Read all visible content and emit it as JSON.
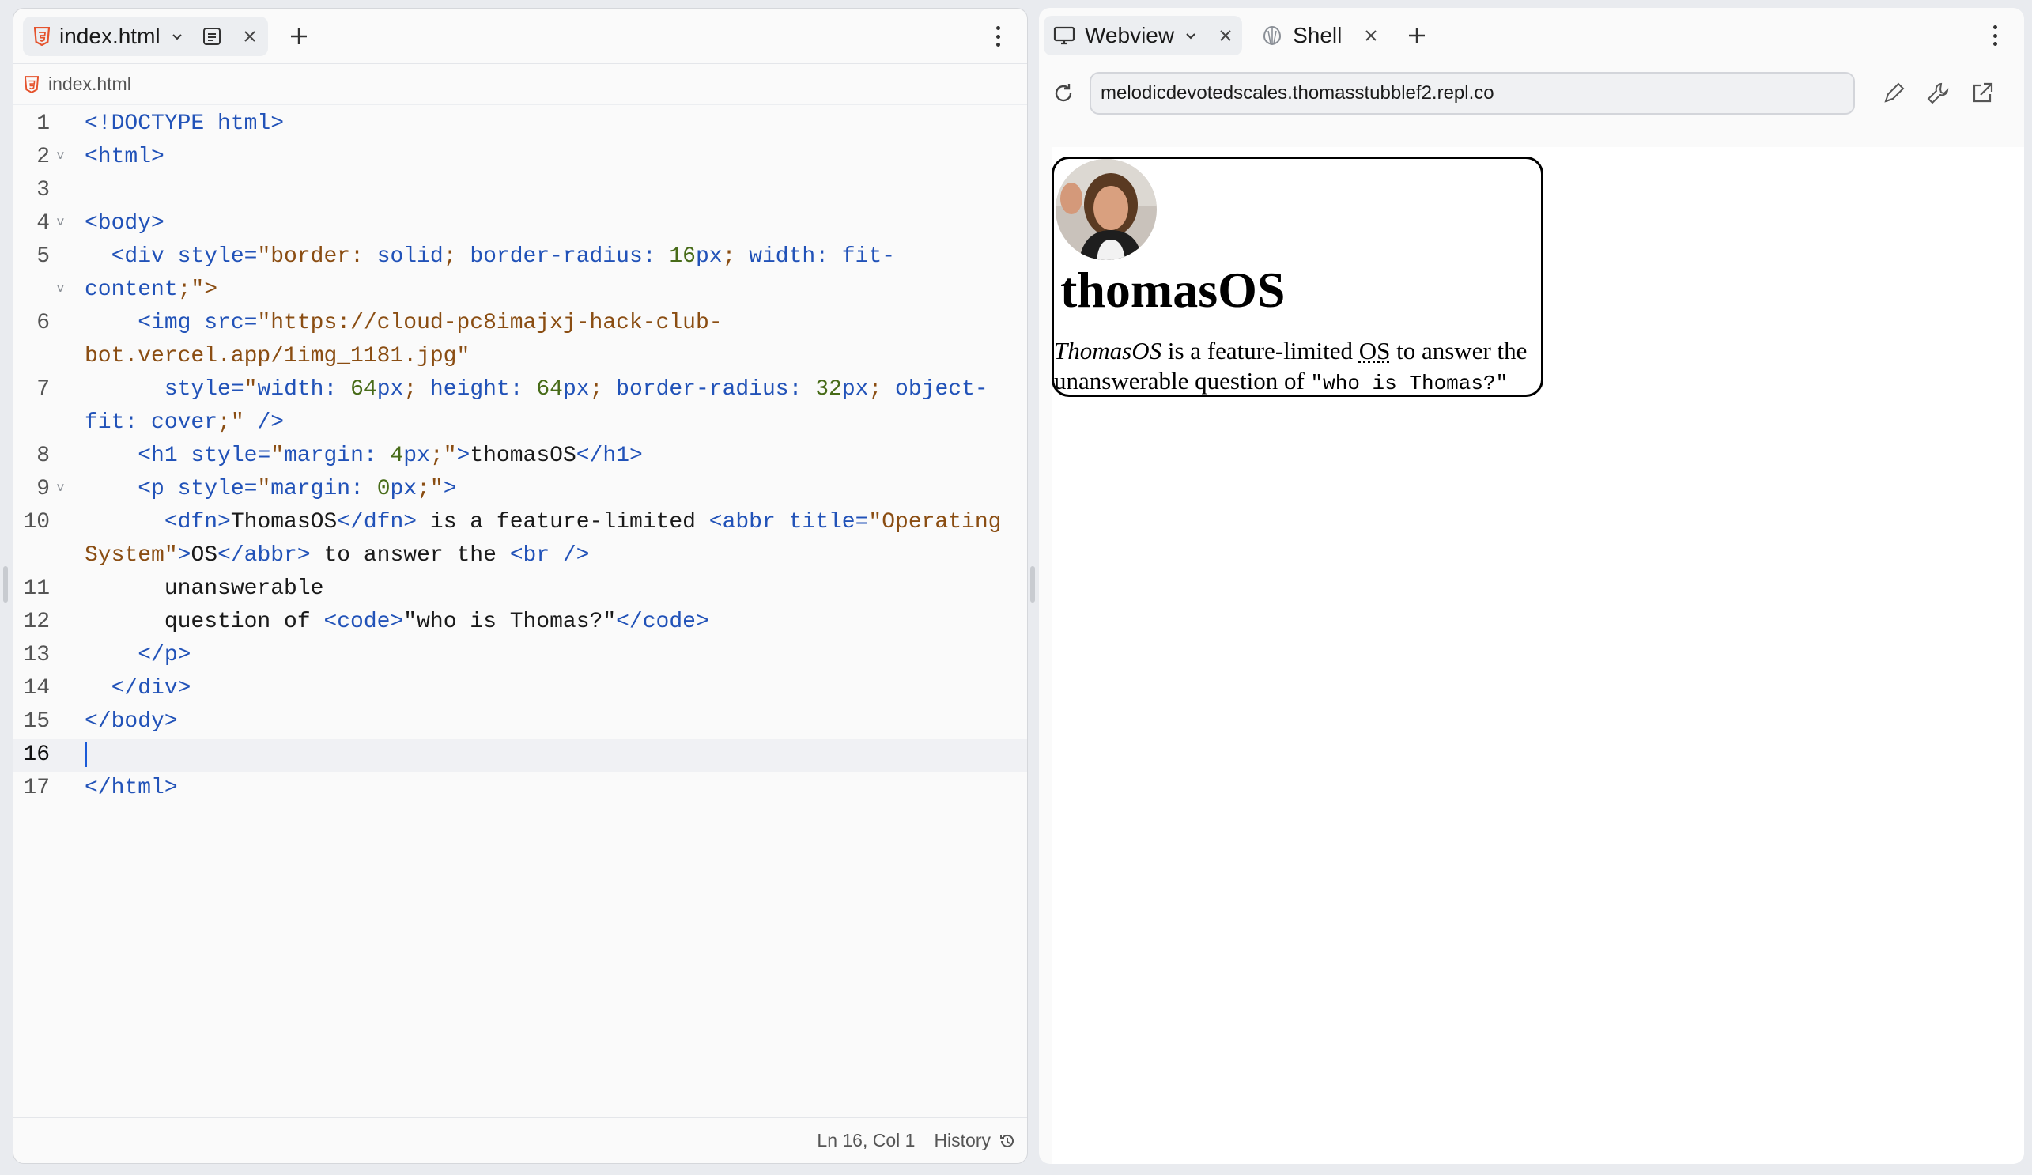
{
  "editor": {
    "tab_title": "index.html",
    "breadcrumb_file": "index.html",
    "lines": [
      {
        "n": "1",
        "tokens": [
          [
            "t-kw",
            "<!DOCTYPE html>"
          ]
        ]
      },
      {
        "n": "2",
        "fold": true,
        "tokens": [
          [
            "t-kw",
            "<html>"
          ]
        ]
      },
      {
        "n": "3",
        "tokens": []
      },
      {
        "n": "4",
        "fold": true,
        "tokens": [
          [
            "t-kw",
            "<body>"
          ]
        ]
      },
      {
        "n": "5",
        "tokens": [
          [
            "t-plain",
            "  "
          ],
          [
            "t-kw",
            "<div style="
          ],
          [
            "t-str",
            "\"border: "
          ],
          [
            "t-kw",
            "solid"
          ],
          [
            "t-str",
            "; "
          ],
          [
            "t-kw",
            "border-radius: "
          ],
          [
            "t-num",
            "16"
          ],
          [
            "t-kw",
            "px"
          ],
          [
            "t-str",
            "; "
          ],
          [
            "t-kw",
            "width: fit-"
          ]
        ]
      },
      {
        "n": "",
        "fold": true,
        "tokens": [
          [
            "t-kw",
            "content"
          ],
          [
            "t-str",
            ";\">"
          ]
        ]
      },
      {
        "n": "6",
        "tokens": [
          [
            "t-plain",
            "    "
          ],
          [
            "t-kw",
            "<img src="
          ],
          [
            "t-str",
            "\"https://cloud-pc8imajxj-hack-club-"
          ]
        ]
      },
      {
        "n": "",
        "tokens": [
          [
            "t-str",
            "bot.vercel.app/1img_1181.jpg\""
          ]
        ]
      },
      {
        "n": "7",
        "tokens": [
          [
            "t-plain",
            "      "
          ],
          [
            "t-kw",
            "style="
          ],
          [
            "t-str",
            "\""
          ],
          [
            "t-kw",
            "width: "
          ],
          [
            "t-num",
            "64"
          ],
          [
            "t-kw",
            "px"
          ],
          [
            "t-str",
            "; "
          ],
          [
            "t-kw",
            "height: "
          ],
          [
            "t-num",
            "64"
          ],
          [
            "t-kw",
            "px"
          ],
          [
            "t-str",
            "; "
          ],
          [
            "t-kw",
            "border-radius: "
          ],
          [
            "t-num",
            "32"
          ],
          [
            "t-kw",
            "px"
          ],
          [
            "t-str",
            "; "
          ],
          [
            "t-kw",
            "object-"
          ]
        ]
      },
      {
        "n": "",
        "tokens": [
          [
            "t-kw",
            "fit: cover"
          ],
          [
            "t-str",
            ";\""
          ],
          [
            "t-kw",
            " />"
          ]
        ]
      },
      {
        "n": "8",
        "tokens": [
          [
            "t-plain",
            "    "
          ],
          [
            "t-kw",
            "<h1 style="
          ],
          [
            "t-str",
            "\""
          ],
          [
            "t-kw",
            "margin: "
          ],
          [
            "t-num",
            "4"
          ],
          [
            "t-kw",
            "px"
          ],
          [
            "t-str",
            ";\""
          ],
          [
            "t-kw",
            ">"
          ],
          [
            "t-plain",
            "thomasOS"
          ],
          [
            "t-kw",
            "</h1>"
          ]
        ]
      },
      {
        "n": "9",
        "fold": true,
        "tokens": [
          [
            "t-plain",
            "    "
          ],
          [
            "t-kw",
            "<p style="
          ],
          [
            "t-str",
            "\""
          ],
          [
            "t-kw",
            "margin: "
          ],
          [
            "t-num",
            "0"
          ],
          [
            "t-kw",
            "px"
          ],
          [
            "t-str",
            ";\""
          ],
          [
            "t-kw",
            ">"
          ]
        ]
      },
      {
        "n": "10",
        "tokens": [
          [
            "t-plain",
            "      "
          ],
          [
            "t-kw",
            "<dfn>"
          ],
          [
            "t-plain",
            "ThomasOS"
          ],
          [
            "t-kw",
            "</dfn>"
          ],
          [
            "t-plain",
            " is a feature-limited "
          ],
          [
            "t-kw",
            "<abbr title="
          ],
          [
            "t-str",
            "\"Operating"
          ]
        ]
      },
      {
        "n": "",
        "tokens": [
          [
            "t-str",
            "System\""
          ],
          [
            "t-kw",
            ">"
          ],
          [
            "t-plain",
            "OS"
          ],
          [
            "t-kw",
            "</abbr>"
          ],
          [
            "t-plain",
            " to answer the "
          ],
          [
            "t-kw",
            "<br />"
          ]
        ]
      },
      {
        "n": "11",
        "tokens": [
          [
            "t-plain",
            "      unanswerable"
          ]
        ]
      },
      {
        "n": "12",
        "tokens": [
          [
            "t-plain",
            "      question of "
          ],
          [
            "t-kw",
            "<code>"
          ],
          [
            "t-plain",
            "\"who is Thomas?\""
          ],
          [
            "t-kw",
            "</code>"
          ]
        ]
      },
      {
        "n": "13",
        "tokens": [
          [
            "t-plain",
            "    "
          ],
          [
            "t-kw",
            "</p>"
          ]
        ]
      },
      {
        "n": "14",
        "tokens": [
          [
            "t-plain",
            "  "
          ],
          [
            "t-kw",
            "</div>"
          ]
        ]
      },
      {
        "n": "15",
        "tokens": [
          [
            "t-kw",
            "</body>"
          ]
        ]
      },
      {
        "n": "16",
        "active": true,
        "tokens": []
      },
      {
        "n": "17",
        "tokens": [
          [
            "t-kw",
            "</html>"
          ]
        ]
      }
    ],
    "status_position": "Ln 16, Col 1",
    "status_history": "History"
  },
  "webview": {
    "tab_webview": "Webview",
    "tab_shell": "Shell",
    "url": "melodicdevotedscales.thomasstubblef2.repl.co",
    "page": {
      "title": "thomasOS",
      "dfn": "ThomasOS",
      "text_1": " is a feature-limited ",
      "abbr": "OS",
      "abbr_title": "Operating System",
      "text_2": " to answer the",
      "text_3": "unanswerable question of ",
      "code": "\"who is Thomas?\""
    }
  },
  "colors": {
    "keyword": "#2152b8",
    "string": "#8a4d12",
    "number": "#476b18",
    "caret": "#1a5ad8",
    "html_icon": "#e5532d"
  },
  "icons": {
    "file_type": "html5-icon",
    "monitor": "monitor-icon",
    "shell": "shell-icon",
    "reload": "reload-icon",
    "edit": "pencil-icon",
    "devtools": "wrench-icon",
    "open_external": "external-link-icon"
  }
}
